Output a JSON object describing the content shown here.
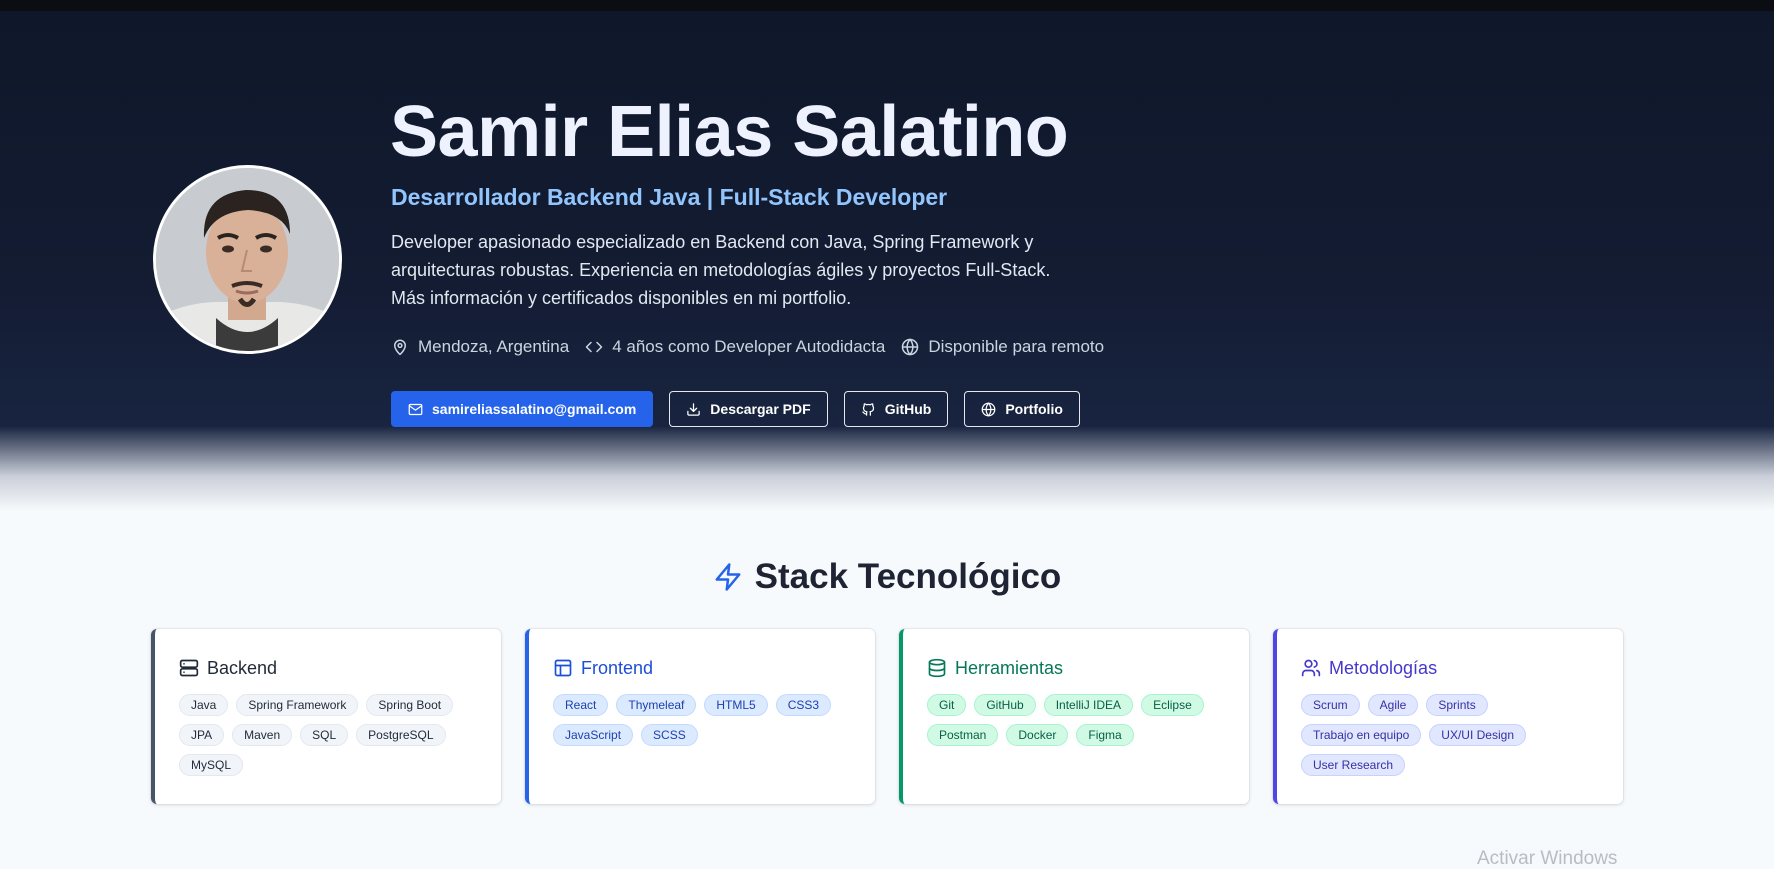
{
  "profile": {
    "name": "Samir Elias Salatino",
    "role": "Desarrollador Backend Java | Full-Stack Developer",
    "bio": "Developer apasionado especializado en Backend con Java, Spring Framework y arquitecturas robustas. Experiencia en metodologías ágiles y proyectos Full-Stack. Más información y certificados disponibles en mi portfolio.",
    "meta": [
      {
        "icon": "map-pin-icon",
        "text": "Mendoza, Argentina"
      },
      {
        "icon": "code-icon",
        "text": "4 años como Developer Autodidacta"
      },
      {
        "icon": "globe-icon",
        "text": "Disponible para remoto"
      }
    ],
    "buttons": [
      {
        "icon": "mail-icon",
        "label": "samireliassalatino@gmail.com"
      },
      {
        "icon": "download-icon",
        "label": "Descargar PDF"
      },
      {
        "icon": "github-icon",
        "label": "GitHub"
      },
      {
        "icon": "globe-icon",
        "label": "Portfolio"
      }
    ]
  },
  "stack": {
    "title": "Stack Tecnológico",
    "icon": "lightning-icon",
    "categories": [
      {
        "icon": "server-icon",
        "title": "Backend",
        "color": "#475569",
        "tags": [
          "Java",
          "Spring Framework",
          "Spring Boot",
          "JPA",
          "Maven",
          "SQL",
          "PostgreSQL",
          "MySQL"
        ]
      },
      {
        "icon": "layout-icon",
        "title": "Frontend",
        "color": "#2563eb",
        "tags": [
          "React",
          "Thymeleaf",
          "HTML5",
          "CSS3",
          "JavaScript",
          "SCSS"
        ]
      },
      {
        "icon": "database-icon",
        "title": "Herramientas",
        "color": "#059669",
        "tags": [
          "Git",
          "GitHub",
          "IntelliJ IDEA",
          "Eclipse",
          "Postman",
          "Docker",
          "Figma"
        ]
      },
      {
        "icon": "users-icon",
        "title": "Metodologías",
        "color": "#4f46e5",
        "tags": [
          "Scrum",
          "Agile",
          "Sprints",
          "Trabajo en equipo",
          "UX/UI Design",
          "User Research"
        ]
      }
    ]
  },
  "watermark": "Activar Windows",
  "colors": {
    "hero_bg": "#0f172a",
    "accent": "#2563eb",
    "role_text": "#93c5fd"
  }
}
